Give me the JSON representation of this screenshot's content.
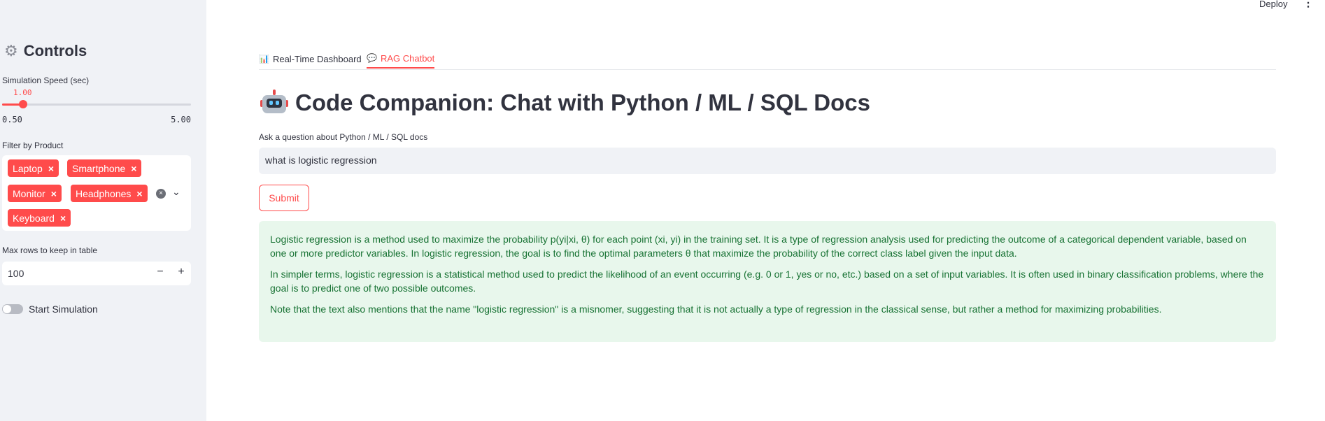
{
  "header": {
    "deploy_label": "Deploy",
    "menu_icon": "⋮"
  },
  "sidebar": {
    "title": "Controls",
    "title_icon": "gear-icon",
    "speed": {
      "label": "Simulation Speed (sec)",
      "current": "1.00",
      "min": "0.50",
      "max": "5.00",
      "value": 1.0,
      "min_value": 0.5,
      "max_value": 5.0
    },
    "filter": {
      "label": "Filter by Product",
      "tags": [
        "Laptop",
        "Smartphone",
        "Monitor",
        "Headphones",
        "Keyboard"
      ],
      "remove_glyph": "×",
      "clear_glyph": "×",
      "caret_glyph": "⌄"
    },
    "max_rows": {
      "label": "Max rows to keep in table",
      "value": "100",
      "minus": "−",
      "plus": "+"
    },
    "simulation": {
      "label": "Start Simulation",
      "on": false
    }
  },
  "tabs": [
    {
      "label": "Real-Time Dashboard",
      "icon": "📊",
      "active": false
    },
    {
      "label": "RAG Chatbot",
      "icon": "💬",
      "active": true
    }
  ],
  "main": {
    "title": "Code Companion: Chat with Python / ML / SQL Docs",
    "question_label": "Ask a question about Python / ML / SQL docs",
    "question_value": "what is logistic regression",
    "submit_label": "Submit",
    "answer": [
      "Logistic regression is a method used to maximize the probability p(yi|xi, θ) for each point (xi, yi) in the training set. It is a type of regression analysis used for predicting the outcome of a categorical dependent variable, based on one or more predictor variables. In logistic regression, the goal is to find the optimal parameters θ that maximize the probability of the correct class label given the input data.",
      "In simpler terms, logistic regression is a statistical method used to predict the likelihood of an event occurring (e.g. 0 or 1, yes or no, etc.) based on a set of input variables. It is often used in binary classification problems, where the goal is to predict one of two possible outcomes.",
      "Note that the text also mentions that the name \"logistic regression\" is a misnomer, suggesting that it is not actually a type of regression in the classical sense, but rather a method for maximizing probabilities."
    ]
  },
  "colors": {
    "accent": "#ff4b4b",
    "sidebar_bg": "#f0f2f6",
    "success_bg": "#e8f7ec",
    "success_text": "#177233"
  }
}
